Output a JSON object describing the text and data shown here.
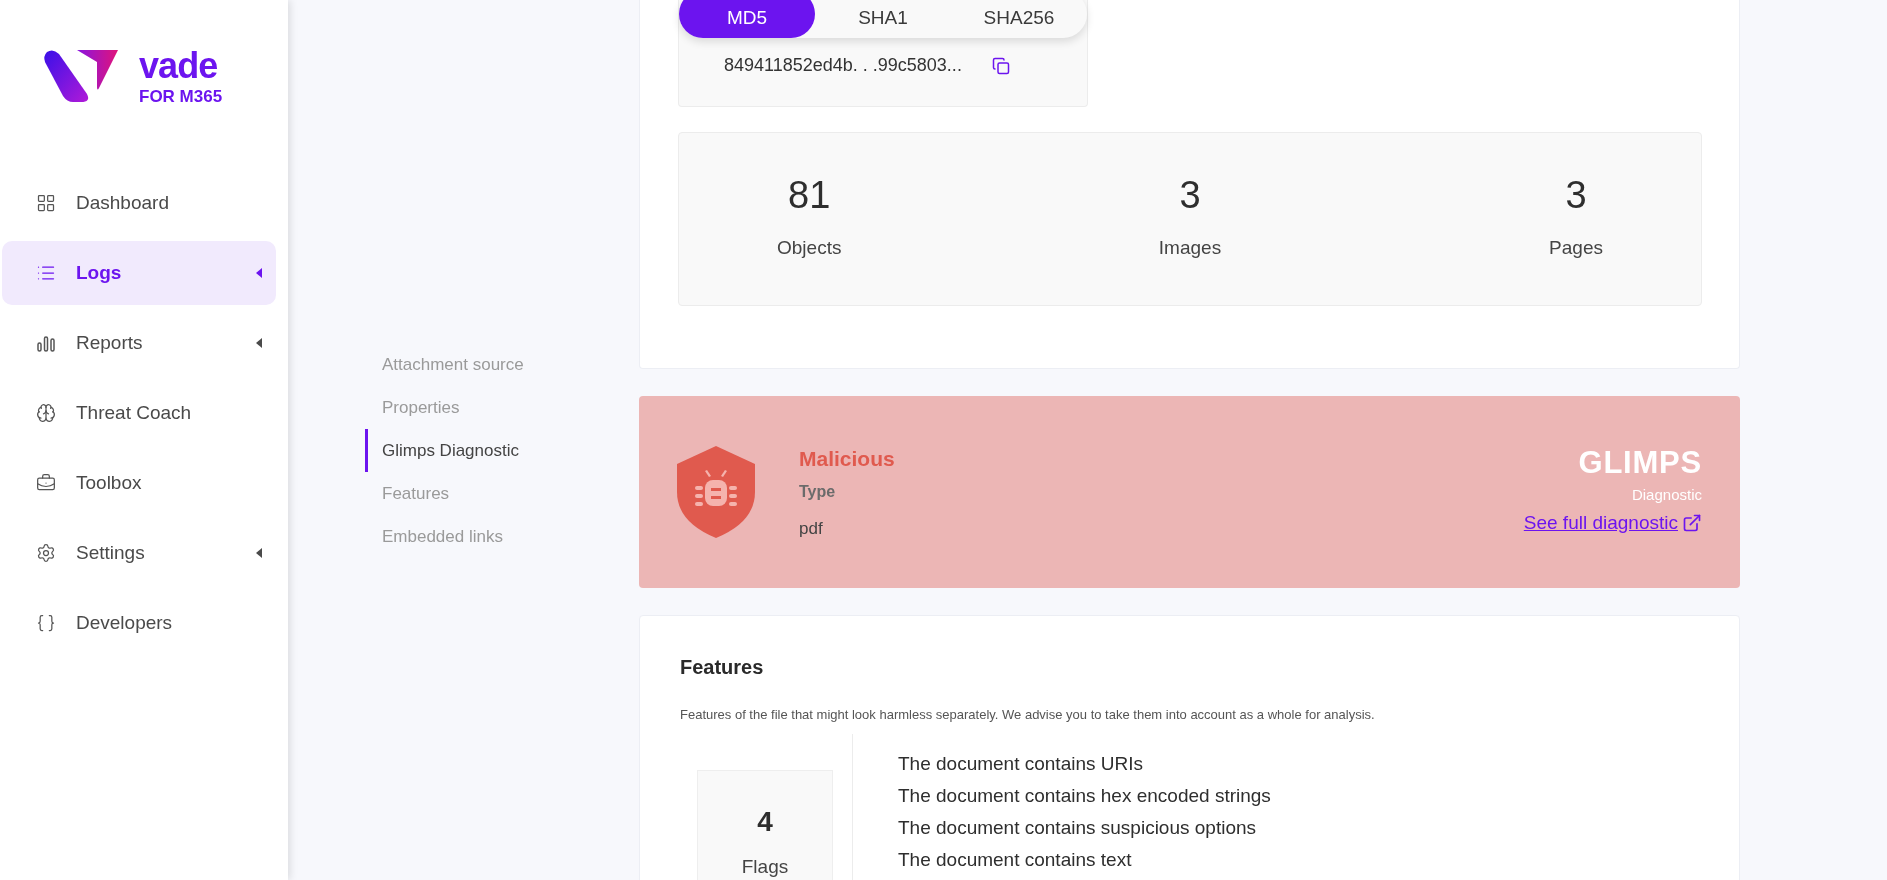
{
  "sidebar": {
    "logo": {
      "name": "vade",
      "subtitle": "FOR M365"
    },
    "items": [
      {
        "label": "Dashboard",
        "selected": false,
        "has_submenu": false
      },
      {
        "label": "Logs",
        "selected": true,
        "has_submenu": true
      },
      {
        "label": "Reports",
        "selected": false,
        "has_submenu": true
      },
      {
        "label": "Threat Coach",
        "selected": false,
        "has_submenu": false
      },
      {
        "label": "Toolbox",
        "selected": false,
        "has_submenu": false
      },
      {
        "label": "Settings",
        "selected": false,
        "has_submenu": true
      },
      {
        "label": "Developers",
        "selected": false,
        "has_submenu": false
      }
    ]
  },
  "section_nav": [
    {
      "label": "Attachment source",
      "selected": false
    },
    {
      "label": "Properties",
      "selected": false
    },
    {
      "label": "Glimps Diagnostic",
      "selected": true
    },
    {
      "label": "Features",
      "selected": false
    },
    {
      "label": "Embedded links",
      "selected": false
    }
  ],
  "hash": {
    "tabs": [
      {
        "label": "MD5",
        "selected": true
      },
      {
        "label": "SHA1",
        "selected": false
      },
      {
        "label": "SHA256",
        "selected": false
      }
    ],
    "value": "849411852ed4b. . .99c5803..."
  },
  "stats": [
    {
      "value": "81",
      "label": "Objects"
    },
    {
      "value": "3",
      "label": "Images"
    },
    {
      "value": "3",
      "label": "Pages"
    }
  ],
  "diagnostic": {
    "verdict": "Malicious",
    "type_label": "Type",
    "type_value": "pdf",
    "provider": "GLIMPS",
    "provider_caption": "Diagnostic",
    "link": "See full diagnostic"
  },
  "features": {
    "title": "Features",
    "description": "Features of the file that might look harmless separately. We advise you to take them into account as a whole for analysis.",
    "flags_count": "4",
    "flags_label": "Flags",
    "items": [
      "The document contains URIs",
      "The document contains hex encoded strings",
      "The document contains suspicious options",
      "The document contains text"
    ]
  }
}
